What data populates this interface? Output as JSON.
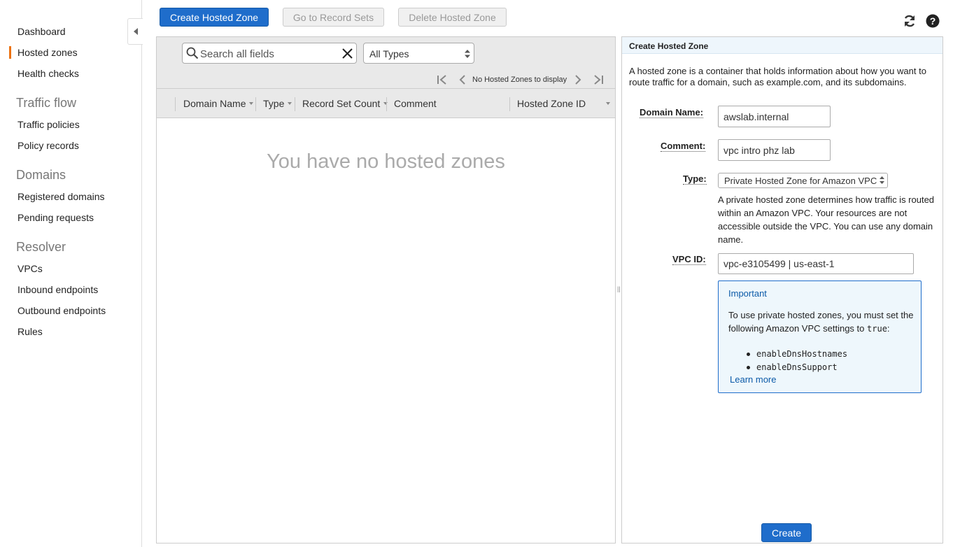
{
  "sidebar": {
    "items": [
      {
        "label": "Dashboard"
      },
      {
        "label": "Hosted zones",
        "active": true
      },
      {
        "label": "Health checks"
      }
    ],
    "sections": [
      {
        "heading": "Traffic flow",
        "items": [
          {
            "label": "Traffic policies"
          },
          {
            "label": "Policy records"
          }
        ]
      },
      {
        "heading": "Domains",
        "items": [
          {
            "label": "Registered domains"
          },
          {
            "label": "Pending requests"
          }
        ]
      },
      {
        "heading": "Resolver",
        "items": [
          {
            "label": "VPCs"
          },
          {
            "label": "Inbound endpoints"
          },
          {
            "label": "Outbound endpoints"
          },
          {
            "label": "Rules"
          }
        ]
      }
    ],
    "active_accent": "#ec7211"
  },
  "toolbar": {
    "create_label": "Create Hosted Zone",
    "goto_label": "Go to Record Sets",
    "delete_label": "Delete Hosted Zone",
    "refresh_icon": "refresh-icon",
    "help_icon": "help-icon"
  },
  "list": {
    "search_placeholder": "Search all fields",
    "type_filter": "All Types",
    "pager_text": "No Hosted Zones to display",
    "columns": [
      "Domain Name",
      "Type",
      "Record Set Count",
      "Comment",
      "Hosted Zone ID"
    ],
    "empty_message": "You have no hosted zones"
  },
  "create_panel": {
    "title": "Create Hosted Zone",
    "intro": "A hosted zone is a container that holds information about how you want to route traffic for a domain, such as example.com, and its subdomains.",
    "domain_label": "Domain Name:",
    "domain_value": "awslab.internal",
    "comment_label": "Comment:",
    "comment_value": "vpc intro phz lab",
    "type_label": "Type:",
    "type_value": "Private Hosted Zone for Amazon VPC",
    "type_help": "A private hosted zone determines how traffic is routed within an Amazon VPC. Your resources are not accessible outside the VPC. You can use any domain name.",
    "vpc_label": "VPC ID:",
    "vpc_value": "vpc-e3105499 | us-east-1",
    "important_title": "Important",
    "important_body": "To use private hosted zones, you must set the following Amazon VPC settings to",
    "important_true": "true",
    "important_colon": ":",
    "settings": [
      "enableDnsHostnames",
      "enableDnsSupport"
    ],
    "learn_more": "Learn more",
    "create_button": "Create"
  },
  "colors": {
    "primary": "#1f6dcb",
    "link": "#0b5aa8",
    "important_bg": "#eef7fc"
  }
}
